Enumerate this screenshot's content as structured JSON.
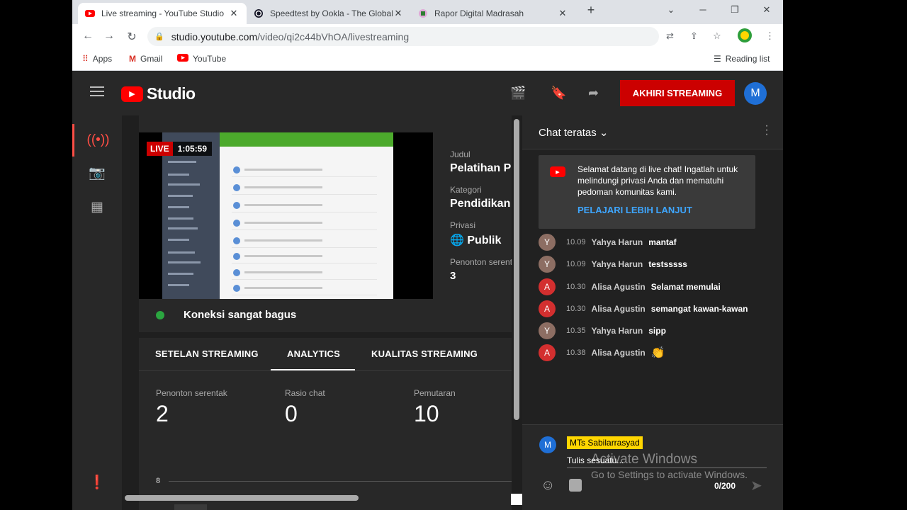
{
  "browser": {
    "tabs": [
      {
        "title": "Live streaming - YouTube Studio",
        "active": true
      },
      {
        "title": "Speedtest by Ookla - The Global",
        "active": false
      },
      {
        "title": "Rapor Digital Madrasah",
        "active": false
      }
    ],
    "new_tab": "+",
    "url_host": "studio.youtube.com",
    "url_path": "/video/qi2c44bVhOA/livestreaming",
    "bookmarks": [
      "Apps",
      "Gmail",
      "YouTube"
    ],
    "reading_list": "Reading list"
  },
  "header": {
    "logo_text": "Studio",
    "end_stream_label": "AKHIRI STREAMING",
    "avatar_letter": "M"
  },
  "stream": {
    "live_label": "LIVE",
    "elapsed": "1:05:59",
    "connection": "Koneksi sangat bagus",
    "info": [
      {
        "label": "Judul",
        "value": "Pelatihan P"
      },
      {
        "label": "Kategori",
        "value": "Pendidikan"
      },
      {
        "label": "Privasi",
        "value": "Publik"
      },
      {
        "label": "Penonton serent",
        "value": "3"
      }
    ]
  },
  "panel": {
    "tabs": [
      "SETELAN STREAMING",
      "ANALYTICS",
      "KUALITAS STREAMING"
    ],
    "active_tab": "ANALYTICS",
    "metrics": [
      {
        "label": "Penonton serentak",
        "value": "2"
      },
      {
        "label": "Rasio chat",
        "value": "0"
      },
      {
        "label": "Pemutaran",
        "value": "10"
      }
    ],
    "axis_label": "8"
  },
  "chat": {
    "title": "Chat teratas",
    "welcome_text": "Selamat datang di live chat! Ingatlah untuk melindungi privasi Anda dan mematuhi pedoman komunitas kami.",
    "welcome_link": "PELAJARI LEBIH LANJUT",
    "messages": [
      {
        "initial": "Y",
        "time": "10.09",
        "author": "Yahya Harun",
        "text": "mantaf",
        "color": "#8d6e63"
      },
      {
        "initial": "Y",
        "time": "10.09",
        "author": "Yahya Harun",
        "text": "testsssss",
        "color": "#8d6e63"
      },
      {
        "initial": "A",
        "time": "10.30",
        "author": "Alisa Agustin",
        "text": "Selamat memulai",
        "color": "#d32f2f"
      },
      {
        "initial": "A",
        "time": "10.30",
        "author": "Alisa Agustin",
        "text": "semangat kawan-kawan",
        "color": "#d32f2f"
      },
      {
        "initial": "Y",
        "time": "10.35",
        "author": "Yahya Harun",
        "text": "sipp",
        "color": "#8d6e63"
      },
      {
        "initial": "A",
        "time": "10.38",
        "author": "Alisa Agustin",
        "text": "👏",
        "color": "#d32f2f"
      }
    ],
    "composer_name": "MTs Sabilarrasyad",
    "composer_avatar": "M",
    "composer_placeholder": "Tulis sesuatu...",
    "char_count": "0/200"
  },
  "watermark": {
    "line1": "Activate Windows",
    "line2": "Go to Settings to activate Windows."
  }
}
